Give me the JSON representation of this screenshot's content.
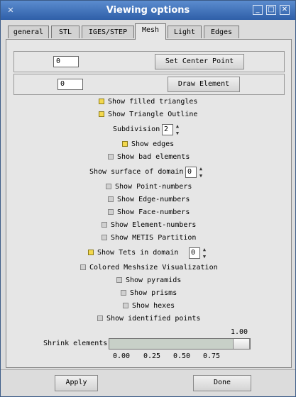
{
  "window": {
    "title": "Viewing options",
    "app_icon": "✕",
    "controls": {
      "minimize": "_",
      "maximize": "□",
      "close": "✕"
    }
  },
  "tabs": [
    {
      "label": "general",
      "active": false
    },
    {
      "label": "STL",
      "active": false
    },
    {
      "label": "IGES/STEP",
      "active": false
    },
    {
      "label": "Mesh",
      "active": true
    },
    {
      "label": "Light",
      "active": false
    },
    {
      "label": "Edges",
      "active": false
    }
  ],
  "mesh": {
    "center_point_value": "0",
    "set_center_point_label": "Set Center Point",
    "draw_element_value": "0",
    "draw_element_label": "Draw Element",
    "show_filled_triangles": "Show filled triangles",
    "show_triangle_outline": "Show Triangle Outline",
    "subdivision_label": "Subdivision",
    "subdivision_value": "2",
    "show_edges": "Show edges",
    "show_bad_elements": "Show bad elements",
    "show_surface_of_domain_label": "Show surface of domain",
    "surface_domain_value": "0",
    "show_point_numbers": "Show Point-numbers",
    "show_edge_numbers": "Show Edge-numbers",
    "show_face_numbers": "Show Face-numbers",
    "show_element_numbers": "Show Element-numbers",
    "show_metis_partition": "Show METIS Partition",
    "show_tets_in_domain": "Show Tets in domain",
    "tets_domain_value": "0",
    "colored_meshsize": "Colored Meshsize Visualization",
    "show_pyramids": "Show pyramids",
    "show_prisms": "Show prisms",
    "show_hexes": "Show hexes",
    "show_identified_points": "Show identified points",
    "shrink_label": "Shrink elements",
    "shrink_value": "1.00",
    "shrink_level": 1.0,
    "shrink_ticks": [
      "0.00",
      "0.25",
      "0.50",
      "0.75"
    ]
  },
  "checks": {
    "filled_triangles": true,
    "triangle_outline": true,
    "edges": true,
    "bad_elements": false,
    "point_numbers": false,
    "edge_numbers": false,
    "face_numbers": false,
    "element_numbers": false,
    "metis_partition": false,
    "tets_in_domain": true,
    "colored_meshsize": false,
    "pyramids": false,
    "prisms": false,
    "hexes": false,
    "identified_points": false
  },
  "footer": {
    "apply_label": "Apply",
    "done_label": "Done"
  },
  "icons": {
    "spin_up": "▲",
    "spin_down": "▼"
  }
}
